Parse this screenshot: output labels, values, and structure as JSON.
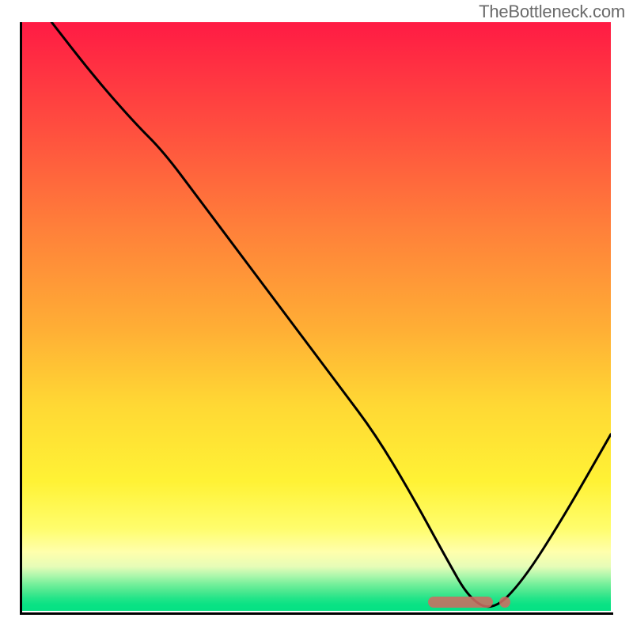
{
  "watermark": "TheBottleneck.com",
  "chart_data": {
    "type": "line",
    "title": "",
    "xlabel": "",
    "ylabel": "",
    "xlim": [
      0,
      100
    ],
    "ylim": [
      0,
      100
    ],
    "grid": false,
    "legend": false,
    "background": "vertical-gradient red→orange→yellow→green",
    "background_meaning": "bottleneck severity (red high, green low)",
    "series": [
      {
        "name": "bottleneck-curve",
        "color": "#000000",
        "x": [
          5,
          12,
          19,
          24,
          30,
          36,
          42,
          48,
          54,
          60,
          66,
          72,
          76,
          80,
          85,
          92,
          100
        ],
        "y": [
          100,
          91,
          83,
          78,
          70,
          62,
          54,
          46,
          38,
          30,
          20,
          9,
          2,
          0,
          5,
          16,
          30
        ]
      }
    ],
    "markers": [
      {
        "name": "optimal-range",
        "type": "band",
        "x_start": 69,
        "x_end": 80,
        "y": 1.5,
        "color": "#cc6d62"
      },
      {
        "name": "optimal-dot",
        "type": "point",
        "x": 82,
        "y": 1.5,
        "color": "#cc6d62"
      }
    ],
    "axes": {
      "left": true,
      "bottom": true,
      "ticks": false,
      "labels": false
    }
  }
}
